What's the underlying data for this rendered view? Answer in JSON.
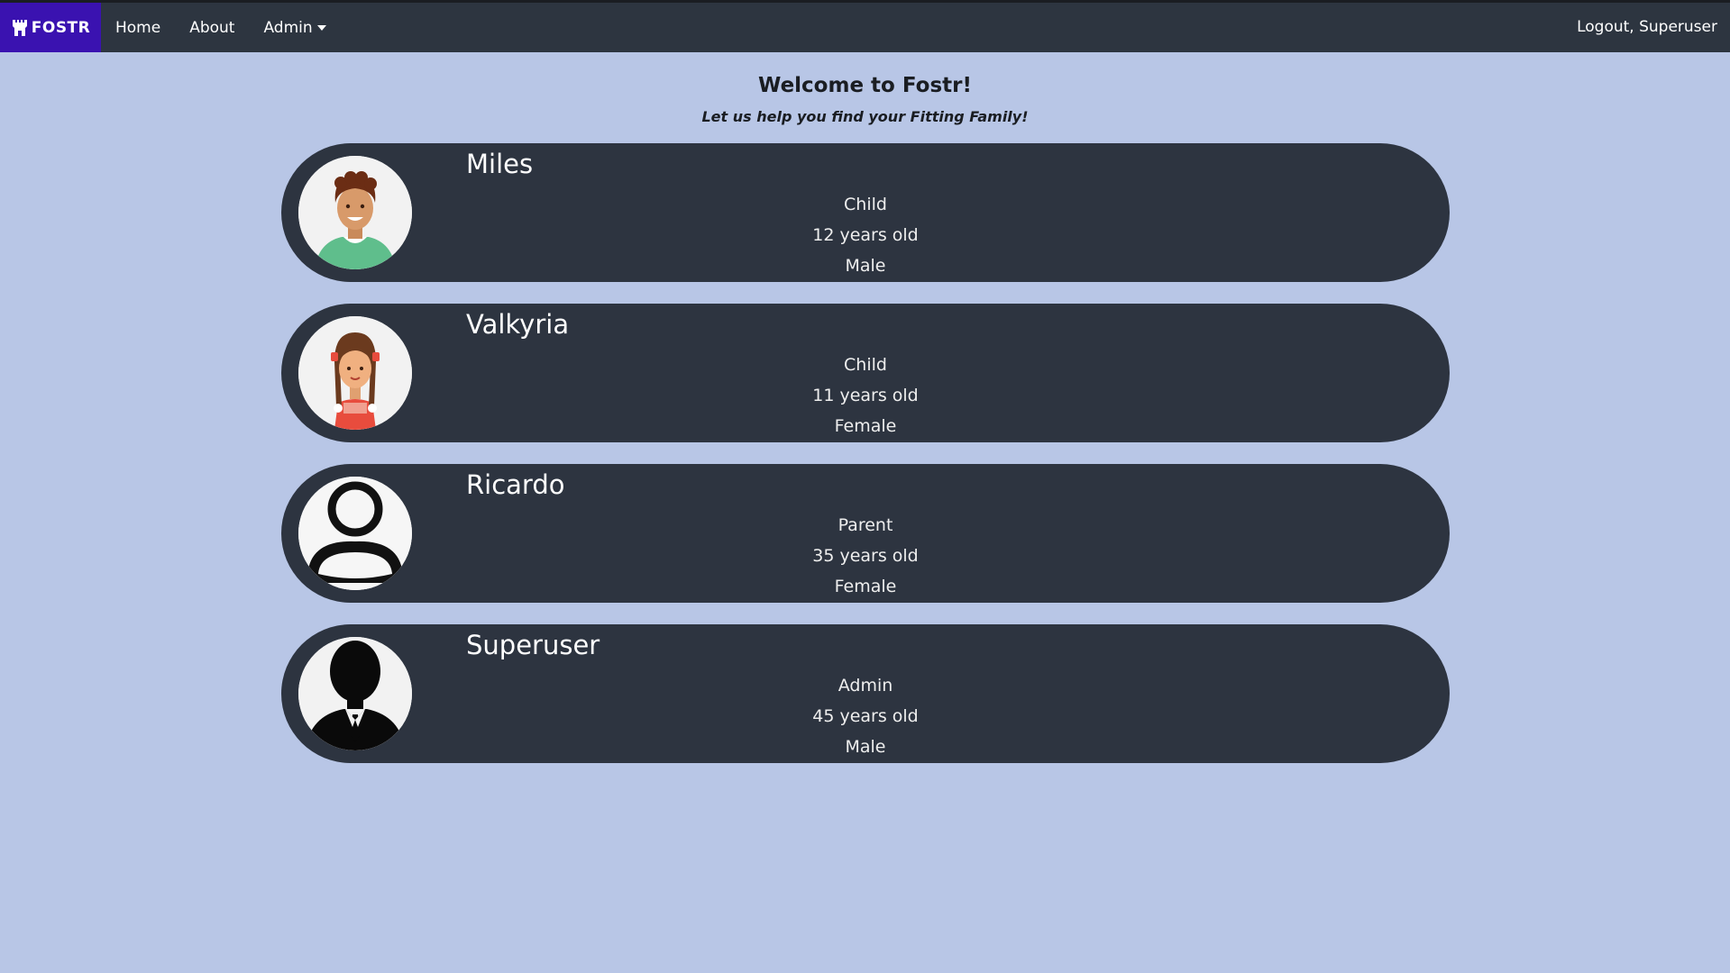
{
  "nav": {
    "brand": "FOSTR",
    "home": "Home",
    "about": "About",
    "admin": "Admin",
    "logout": "Logout, Superuser"
  },
  "header": {
    "title": "Welcome to Fostr!",
    "tagline": "Let us help you find your Fitting Family!"
  },
  "profiles": [
    {
      "name": "Miles",
      "role": "Child",
      "age": "12 years old",
      "gender": "Male",
      "avatar": "boy-avatar-icon"
    },
    {
      "name": "Valkyria",
      "role": "Child",
      "age": "11 years old",
      "gender": "Female",
      "avatar": "girl-avatar-icon"
    },
    {
      "name": "Ricardo",
      "role": "Parent",
      "age": "35 years old",
      "gender": "Female",
      "avatar": "user-outline-icon"
    },
    {
      "name": "Superuser",
      "role": "Admin",
      "age": "45 years old",
      "gender": "Male",
      "avatar": "business-person-icon"
    }
  ],
  "colors": {
    "page_bg": "#b8c6e6",
    "navbar_bg": "#2d3540",
    "brand_bg": "#3a12b0",
    "card_bg": "#2d3440"
  }
}
